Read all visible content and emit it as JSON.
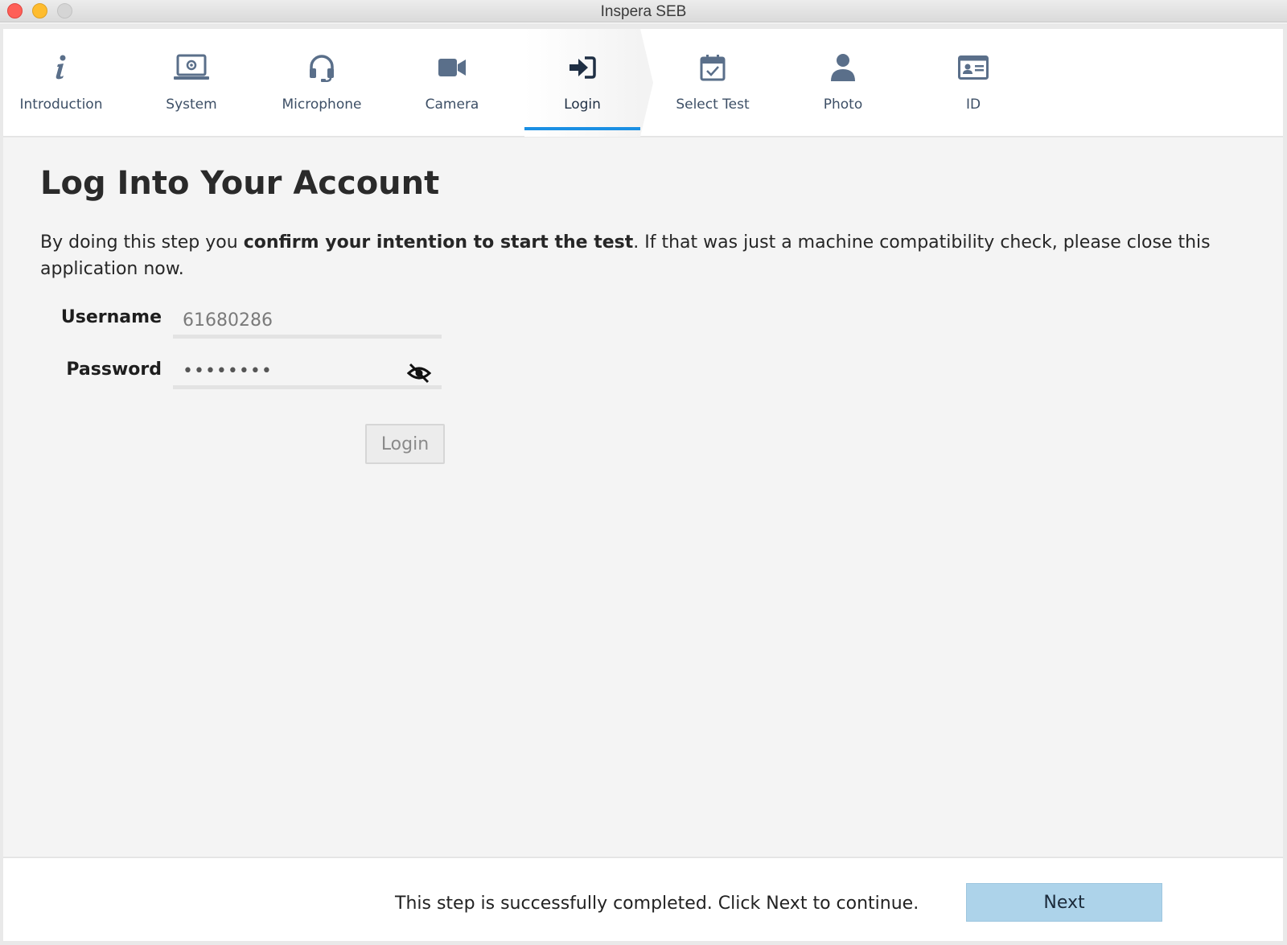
{
  "window": {
    "title": "Inspera SEB"
  },
  "tabs": [
    {
      "label": "Introduction",
      "icon": "info-icon"
    },
    {
      "label": "System",
      "icon": "laptop-icon"
    },
    {
      "label": "Microphone",
      "icon": "headset-icon"
    },
    {
      "label": "Camera",
      "icon": "video-camera-icon"
    },
    {
      "label": "Login",
      "icon": "sign-in-icon",
      "active": true
    },
    {
      "label": "Select Test",
      "icon": "calendar-check-icon"
    },
    {
      "label": "Photo",
      "icon": "user-icon"
    },
    {
      "label": "ID",
      "icon": "id-card-icon"
    }
  ],
  "main": {
    "title": "Log Into Your Account",
    "intro_before": "By doing this step you ",
    "intro_bold": "confirm your intention to start the test",
    "intro_after": ". If that was just a machine compatibility check, please close this application now."
  },
  "form": {
    "username_label": "Username",
    "username_value": "61680286",
    "password_label": "Password",
    "password_value": "••••••••",
    "login_button": "Login"
  },
  "footer": {
    "status": "This step is successfully completed. Click Next to continue.",
    "next_button": "Next"
  },
  "colors": {
    "accent": "#1a8fe3",
    "next_button": "#add3ea",
    "icon": "#5a6f8a"
  }
}
